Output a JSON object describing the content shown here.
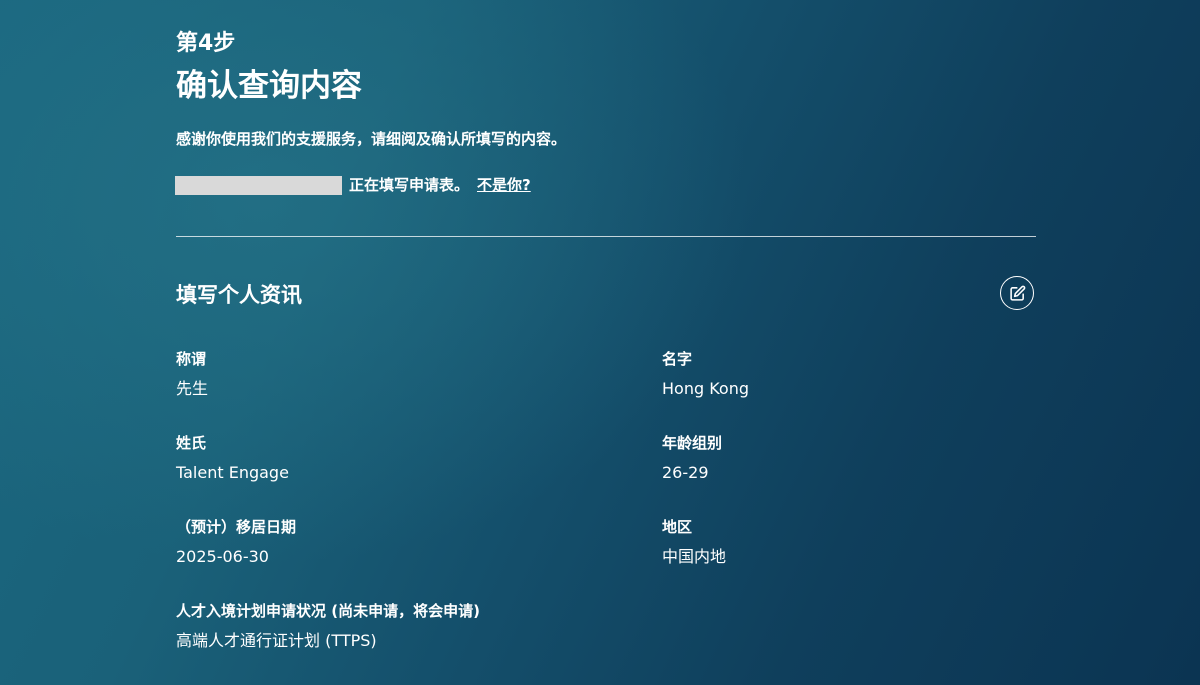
{
  "header": {
    "step_label": "第4步",
    "title": "确认查询内容",
    "intro": "感谢你使用我们的支援服务，请细阅及确认所填写的内容。"
  },
  "user_line": {
    "status_text": "正在填写申请表。",
    "not_you_link": "不是你?"
  },
  "section": {
    "title": "填写个人资讯",
    "edit_icon": "edit-icon"
  },
  "fields": {
    "salutation": {
      "label": "称谓",
      "value": "先生"
    },
    "first_name": {
      "label": "名字",
      "value": "Hong Kong"
    },
    "surname": {
      "label": "姓氏",
      "value": "Talent Engage"
    },
    "age_group": {
      "label": "年龄组别",
      "value": "26-29"
    },
    "move_date": {
      "label": "（预计）移居日期",
      "value": "2025-06-30"
    },
    "region": {
      "label": "地区",
      "value": "中国内地"
    },
    "scheme_status": {
      "label": "人才入境计划申请状况 (尚未申请，将会申请)",
      "value": "高端人才通行证计划 (TTPS)"
    }
  },
  "colors": {
    "text": "#ffffff",
    "redaction": "#d9d9d9",
    "background_start": "#1b6880",
    "background_end": "#0b3452"
  }
}
